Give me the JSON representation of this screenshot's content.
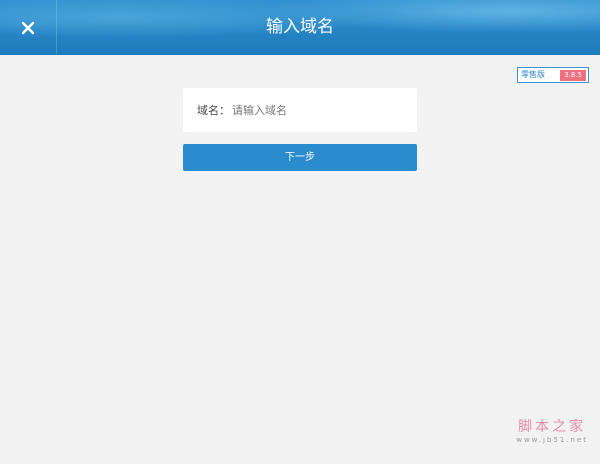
{
  "header": {
    "title": "输入域名",
    "close_icon": "close-icon"
  },
  "badge": {
    "edition": "零售版",
    "version": "3.8.5"
  },
  "form": {
    "domain_label": "域名：",
    "domain_placeholder": "请输入域名",
    "domain_value": "",
    "next_button": "下一步"
  },
  "watermark": {
    "text": "脚本之家",
    "url": "www.jb51.net"
  },
  "colors": {
    "header": "#2185c5",
    "button": "#2a8ccc",
    "background": "#f2f2f2",
    "version_badge": "#f07080"
  }
}
